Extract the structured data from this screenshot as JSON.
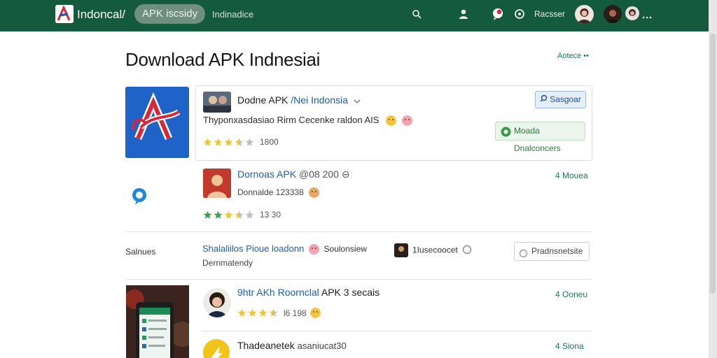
{
  "header": {
    "brand": "Indoncal/",
    "pill_label": "APK iscsidy",
    "nav_text": "Indinadice",
    "user_label": "Racsser"
  },
  "page": {
    "title": "Download APK Indnesiai",
    "top_link": "Aotece ••"
  },
  "featured": {
    "title_prefix": "Dodne APK",
    "title_link": "/Nei Indonsia",
    "description": "Thyponxasdasiao Rirm Cecenke raldon AIS",
    "rating": "1800",
    "stars": 3.5,
    "primary_button": "Sasgoar",
    "secondary_button": "Moada Dnalconcers"
  },
  "list": [
    {
      "title_link": "Dornoas APK",
      "title_rest": "@08 200 ⊖",
      "subtitle": "Donnalde 123338",
      "rating": "13 30",
      "stars": 3.5,
      "action": "4 Mouea"
    },
    {
      "title_link": "9htr AKh Roornclal",
      "title_rest": "APK 3 secais",
      "rating": "l6 198",
      "stars": 3.5,
      "action": "4 Ooneu"
    },
    {
      "title": "Thadeanetek",
      "title_rest": "asaniucat30",
      "action": "4 Siona"
    }
  ],
  "section": {
    "label": "Salnues",
    "link_text": "Shalaliilos Pioue loadonn",
    "suffix": "Soulonsiew",
    "sub": "Dernmatendy",
    "user_text": "1Iusecoocet",
    "button": "Pradnsnetsite"
  },
  "colors": {
    "header_bg": "#135a3e",
    "accent_green": "#1a7a5a",
    "link_blue": "#1b5fb6",
    "star": "#f2c230"
  },
  "icons": [
    "search-icon",
    "user-icon",
    "notification-icon",
    "settings-icon",
    "chevron-down-icon",
    "search-button-icon",
    "download-icon",
    "chat-icon",
    "preview-icon"
  ]
}
